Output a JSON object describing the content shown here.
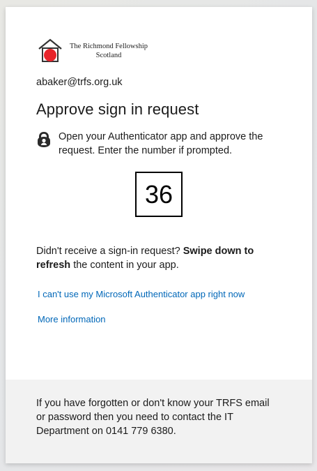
{
  "org": {
    "name_line1": "The Richmond Fellowship",
    "name_line2": "Scotland",
    "brand_color": "#e8232a"
  },
  "account": {
    "email": "abaker@trfs.org.uk"
  },
  "prompt": {
    "title": "Approve sign in request",
    "instruction": "Open your Authenticator app and approve the request. Enter the number if prompted.",
    "number": "36",
    "icon": "authenticator-lock-icon"
  },
  "swipe": {
    "prefix": "Didn't receive a sign-in request? ",
    "bold": "Swipe down to refresh",
    "suffix": " the content in your app."
  },
  "links": {
    "cant_use": "I can't use my Microsoft Authenticator app right now",
    "more_info": "More information",
    "link_color": "#0067b8"
  },
  "footer": {
    "text": "If you have forgotten or don't know your TRFS email or password then you need to contact the IT Department on 0141 779 6380."
  }
}
